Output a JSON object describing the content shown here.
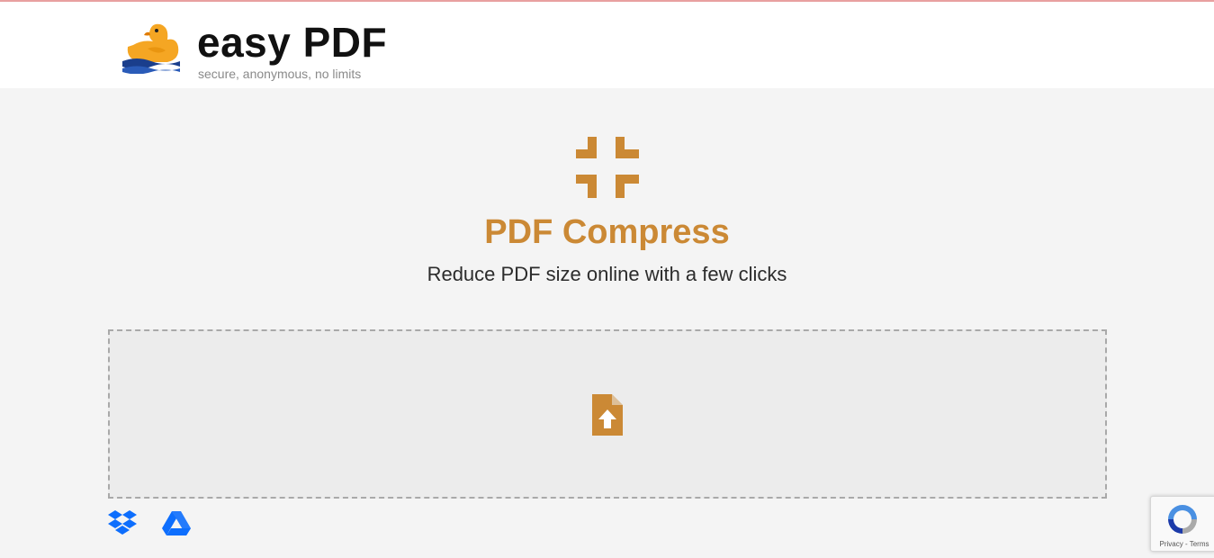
{
  "header": {
    "brand_name": "easy PDF",
    "tagline": "secure, anonymous, no limits",
    "logo_icon": "duck-logo-icon"
  },
  "hero": {
    "icon": "compress-arrows-icon",
    "title": "PDF Compress",
    "subtitle": "Reduce PDF size online with a few clicks"
  },
  "upload": {
    "icon": "file-upload-icon"
  },
  "cloud_sources": [
    {
      "name": "dropbox-icon"
    },
    {
      "name": "google-drive-icon"
    }
  ],
  "recaptcha": {
    "privacy": "Privacy",
    "separator": " - ",
    "terms": "Terms"
  },
  "colors": {
    "accent": "#cb8935",
    "duck": "#f5a623",
    "water": "#1a3e8c",
    "cloud_blue": "#0d6efd",
    "background": "#f4f4f4",
    "dropzone": "#ececec"
  }
}
